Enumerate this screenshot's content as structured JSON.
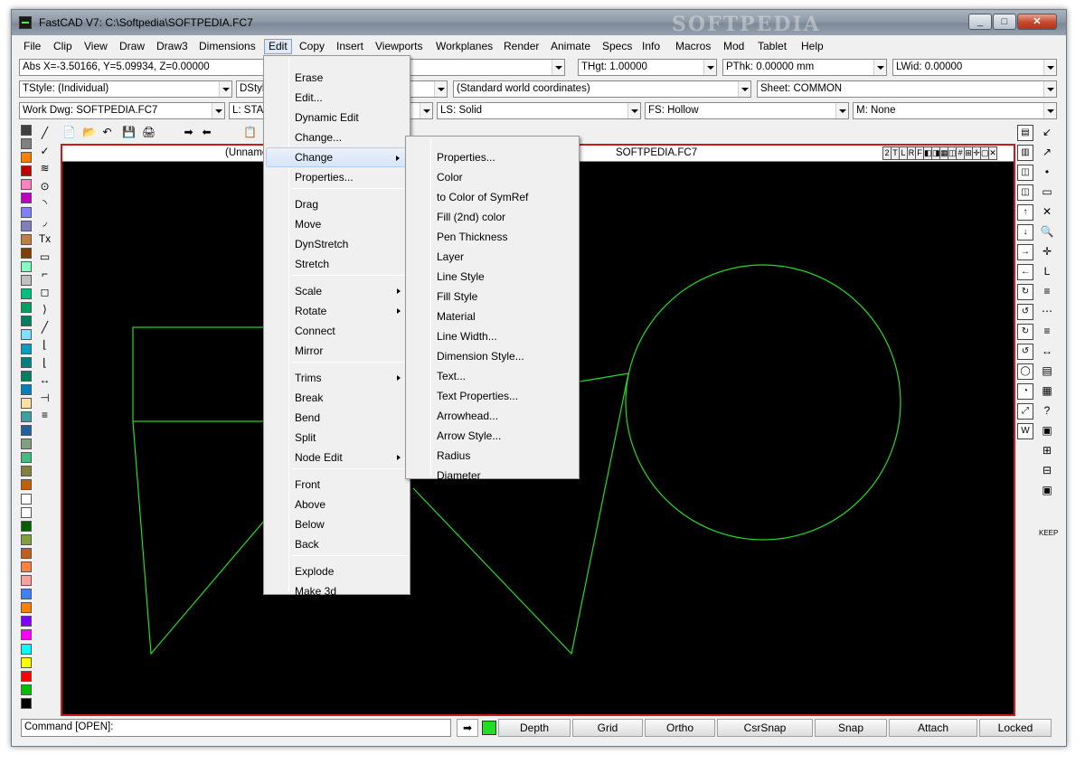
{
  "window": {
    "title": "FastCAD V7: C:\\Softpedia\\SOFTPEDIA.FC7",
    "watermark": "SOFTPEDIA",
    "min_label": "_",
    "max_label": "□",
    "close_label": "✕"
  },
  "menubar": [
    "File",
    "Clip",
    "View",
    "Draw",
    "Draw3",
    "Dimensions",
    "Edit",
    "Copy",
    "Insert",
    "Viewports",
    "Workplanes",
    "Render",
    "Animate",
    "Specs",
    "Info",
    "Macros",
    "Mod",
    "Tablet",
    "Help"
  ],
  "toolbar1": {
    "coords": "Abs X=-3.50166, Y=5.09934, Z=0.00000",
    "thgt": "THgt: 1.00000",
    "pthk": "PThk: 0.00000 mm",
    "lwid": "LWid: 0.00000"
  },
  "toolbar2": {
    "tstyle": "TStyle: (Individual)",
    "dstyle": "DStyl",
    "coordsys": "(Standard world coordinates)",
    "sheet": "Sheet: COMMON"
  },
  "toolbar3": {
    "workdwg": "Work Dwg: SOFTPEDIA.FC7",
    "layer": "L: STA",
    "ls": "LS: Solid",
    "fs": "FS: Hollow",
    "material": "M: None"
  },
  "canvas": {
    "left_title": "(Unname",
    "right_title": "SOFTPEDIA.FC7",
    "view_buttons": [
      "2",
      "T",
      "L",
      "R",
      "F",
      "◧",
      "◨",
      "▦",
      "◫",
      "#",
      "⊞",
      "✛",
      "▢",
      "✕"
    ],
    "line_color": "#22dd22",
    "frame_color": "#cc1a1a"
  },
  "palette": [
    "#404040",
    "#808080",
    "#ff8000",
    "#c00000",
    "#ff80c0",
    "#c000c0",
    "#8080ff",
    "#8080c0",
    "#c08040",
    "#804000",
    "#80ffc0",
    "#c0c0c0",
    "#00c080",
    "#00a060",
    "#008060",
    "#80e0ff",
    "#00a0c0",
    "#008080",
    "#008060",
    "#0080c0",
    "#ffe0a0",
    "#40a0a0",
    "#2060a0",
    "#80a080",
    "#40c080",
    "#808040",
    "#c06000",
    "#ffffff",
    "#ffffff",
    "#006000",
    "#80a040",
    "#c06020",
    "#ff8040",
    "#ffa0a0",
    "#4080ff",
    "#ff8000",
    "#8000ff",
    "#ff00ff",
    "#00ffff",
    "#ffff00",
    "#ff0000",
    "#00c000",
    "#000000"
  ],
  "left_tools": [
    "╱",
    "✓",
    "≋",
    "⊙",
    "◝",
    "◞",
    "Tx",
    "▭",
    "⌐",
    "◻",
    "⟩",
    "╱",
    "⌊",
    "⌊",
    "↔",
    "⊣",
    "≡"
  ],
  "top_tools": [
    "📄",
    "📂",
    "↶",
    "💾",
    "🖨",
    "➡",
    "⬅",
    "📋"
  ],
  "right_tools_a": [
    "▤",
    "▥",
    "◫",
    "◫",
    "↑",
    "↓",
    "→",
    "←",
    "↻",
    "↺",
    "↻",
    "↺",
    "◯",
    "◔",
    "⤢",
    "W"
  ],
  "right_tools_b": [
    "↙",
    "↗",
    "•",
    "▭",
    "✕",
    "🔍",
    "✛",
    "L",
    "≡",
    "⋯",
    "≡",
    "↔",
    "▤",
    "▦",
    "?",
    "▣",
    "⊞",
    "⊟",
    "▣",
    "KEEP"
  ],
  "statusbar": {
    "command": "Command [OPEN]:",
    "buttons": [
      "Depth",
      "Grid",
      "Ortho",
      "CsrSnap",
      "Snap",
      "Attach",
      "Locked"
    ],
    "arrow": "➡"
  },
  "edit_menu": {
    "items": [
      "Erase",
      "Edit...",
      "Dynamic Edit",
      "Change...",
      "Change",
      "Properties...",
      "Drag",
      "Move",
      "DynStretch",
      "Stretch",
      "Scale",
      "Rotate",
      "Connect",
      "Mirror",
      "Trims",
      "Break",
      "Bend",
      "Split",
      "Node Edit",
      "Front",
      "Above",
      "Below",
      "Back",
      "Explode",
      "Make 3d"
    ],
    "highlighted": "Change"
  },
  "change_submenu": {
    "items": [
      "Properties...",
      "Color",
      "to Color of SymRef",
      "Fill (2nd) color",
      "Pen Thickness",
      "Layer",
      "Line Style",
      "Fill Style",
      "Material",
      "Line Width...",
      "Dimension Style...",
      "Text...",
      "Text Properties...",
      "Arrowhead...",
      "Arrow Style...",
      "Radius",
      "Diameter"
    ]
  }
}
